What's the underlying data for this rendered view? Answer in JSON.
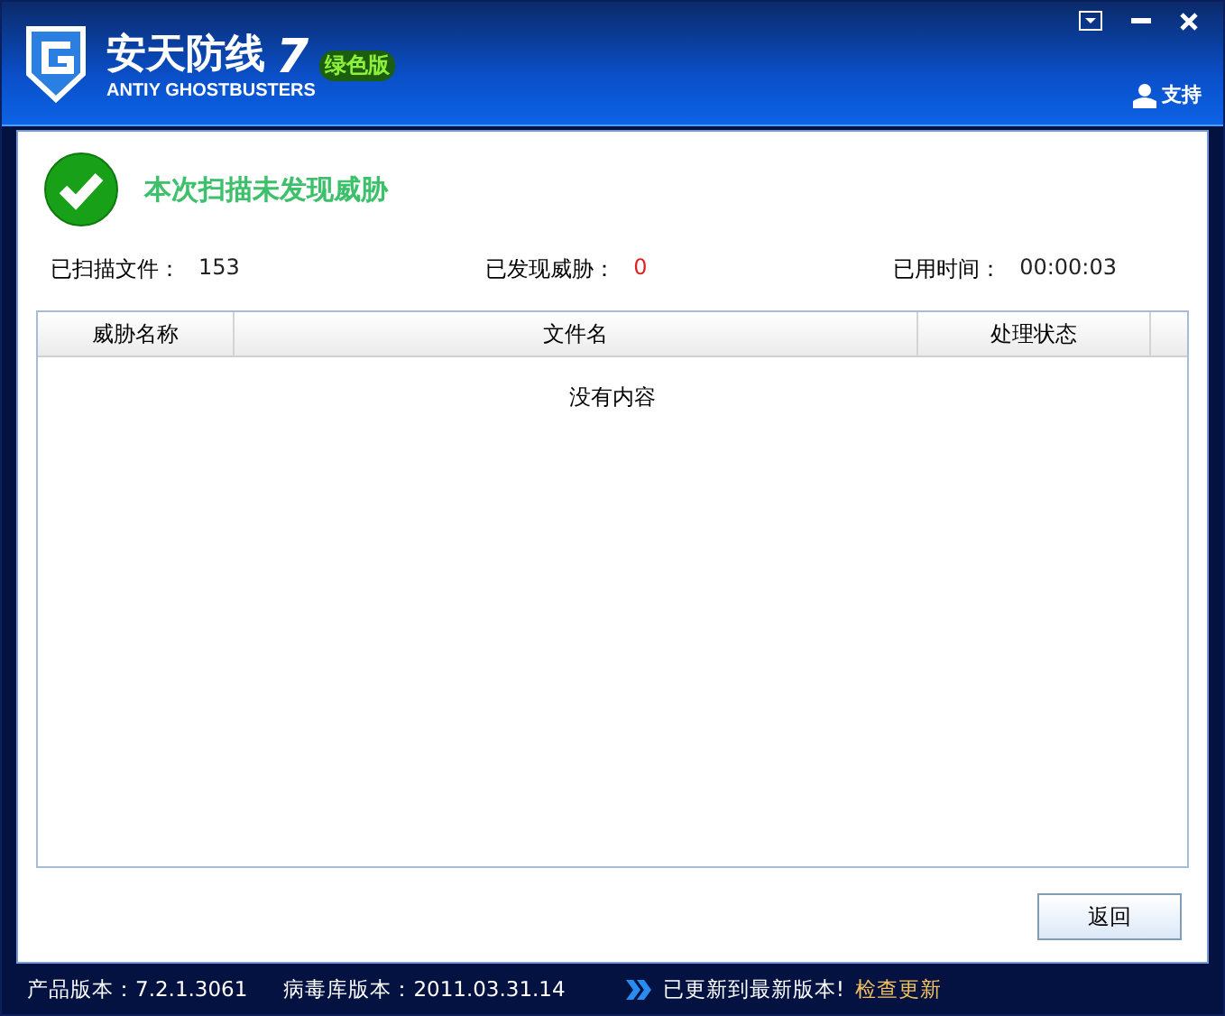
{
  "header": {
    "title": "安天防线",
    "version": "7",
    "edition": "绿色版",
    "subtitle": "ANTIY GHOSTBUSTERS",
    "support": "支持"
  },
  "result": {
    "message": "本次扫描未发现威胁"
  },
  "stats": [
    {
      "label": "已扫描文件：",
      "value": "153",
      "alert": false
    },
    {
      "label": "已发现威胁：",
      "value": "0",
      "alert": true
    },
    {
      "label": "已用时间：",
      "value": "00:00:03",
      "alert": false
    }
  ],
  "table": {
    "columns": [
      "威胁名称",
      "文件名",
      "处理状态"
    ],
    "empty_text": "没有内容"
  },
  "buttons": [
    "返回"
  ],
  "status_bar": {
    "product_version": "产品版本：7.2.1.3061",
    "database_version": "病毒库版本：2011.03.31.14",
    "update_status": "已更新到最新版本!",
    "update_link": "检查更新"
  }
}
